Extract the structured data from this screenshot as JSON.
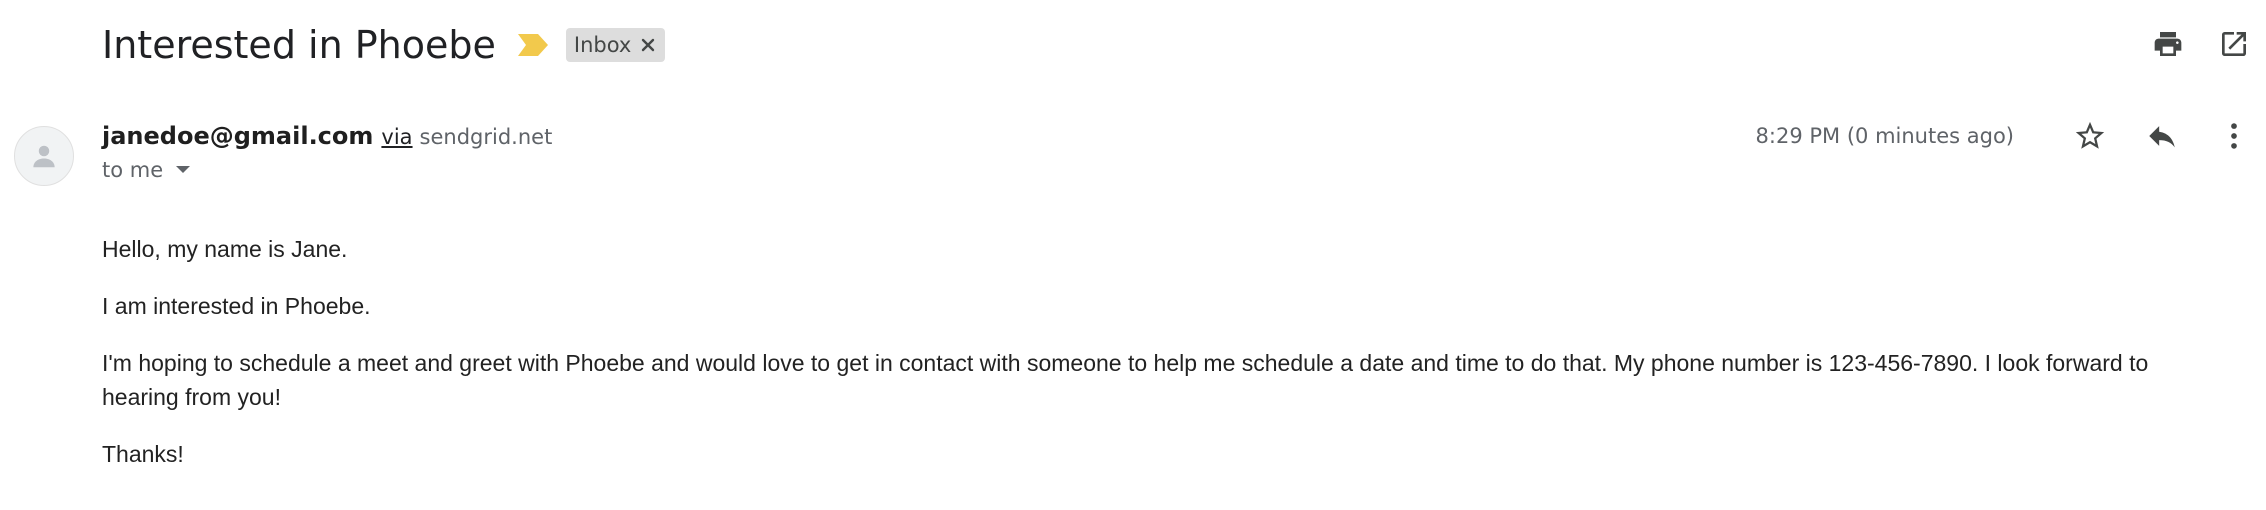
{
  "email": {
    "subject": "Interested in Phoebe",
    "label_chip": "Inbox",
    "sender_email": "janedoe@gmail.com",
    "via_label": "via",
    "via_domain": "sendgrid.net",
    "recipient_label": "to me",
    "timestamp": "8:29 PM (0 minutes ago)",
    "body_paragraphs": [
      "Hello, my name is Jane.",
      "I am interested in Phoebe.",
      "I'm hoping to schedule a meet and greet with Phoebe and would love to get in contact with someone to help me schedule a date and time to do that. My phone number is 123-456-7890. I look forward to hearing from you!",
      "Thanks!"
    ]
  },
  "icons": {
    "importance": "importance-marker-icon",
    "chip_close": "close-icon",
    "print": "print-icon",
    "open_new_window": "open-in-new-window-icon",
    "avatar": "person-avatar-icon",
    "recipient_dropdown": "caret-down-icon",
    "star": "star-outline-icon",
    "reply": "reply-icon",
    "more": "more-vertical-icon"
  },
  "colors": {
    "importance_marker": "#F2C94C",
    "chip_background": "#DDDDDD",
    "icon_gray": "#444746",
    "text_secondary": "#5F6368"
  }
}
